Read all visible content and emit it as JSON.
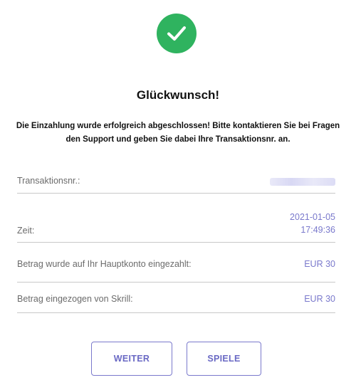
{
  "colors": {
    "success_green": "#2fb35f",
    "accent": "#7a79cc"
  },
  "status_icon": "checkmark-icon",
  "title": "Glückwunsch!",
  "message": "Die Einzahlung wurde erfolgreich abgeschlossen! Bitte kontaktieren Sie bei Fragen den Support und geben Sie dabei Ihre Transaktionsnr. an.",
  "details": {
    "transaction": {
      "label": "Transaktionsnr.:"
    },
    "time": {
      "label": "Zeit:",
      "date": "2021-01-05",
      "clock": "17:49:36"
    },
    "main_account": {
      "label": "Betrag wurde auf Ihr Hauptkonto eingezahlt:",
      "value": "EUR 30"
    },
    "skrill": {
      "label": "Betrag eingezogen von Skrill:",
      "value": "EUR 30"
    }
  },
  "buttons": {
    "continue": "WEITER",
    "games": "SPIELE"
  }
}
